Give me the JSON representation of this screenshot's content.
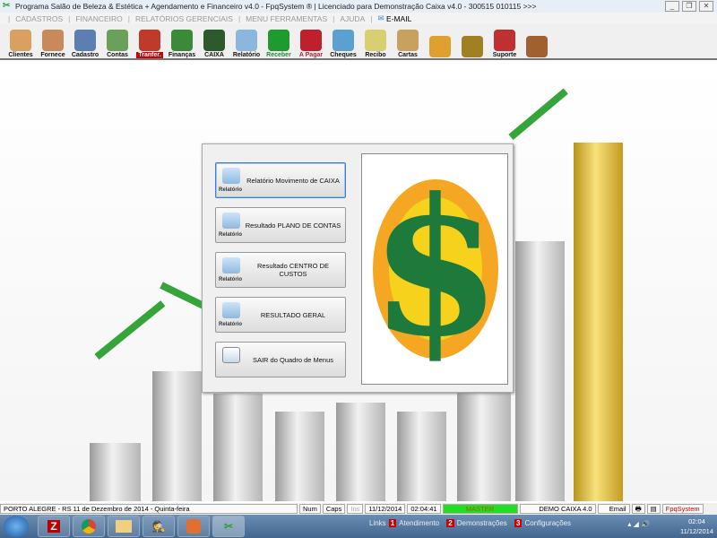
{
  "title": "Programa Salão de Beleza & Estética + Agendamento e Financeiro v4.0 - FpqSystem ® | Licenciado para  Demonstração Caixa v4.0 - 300515 010115 >>>",
  "menu": [
    "CADASTROS",
    "FINANCEIRO",
    "RELATÓRIOS GERENCIAIS",
    "MENU FERRAMENTAS",
    "AJUDA"
  ],
  "menu_email": "E-MAIL",
  "toolbar": [
    {
      "label": "Clientes",
      "color": "#d9a060"
    },
    {
      "label": "Fornece",
      "color": "#c88a5a"
    },
    {
      "label": "Cadastro",
      "color": "#5a7fb0"
    },
    {
      "label": "Contas",
      "color": "#6aa05a"
    },
    {
      "label": "Tranfer.",
      "color": "#c0392b"
    },
    {
      "label": "Finanças",
      "color": "#3a8a3a"
    },
    {
      "label": "CAIXA",
      "color": "#2c5a2c"
    },
    {
      "label": "Relatório",
      "color": "#8ab6e0"
    },
    {
      "label": "Receber",
      "color": "#1e9a2e"
    },
    {
      "label": "A Pagar",
      "color": "#c0202e"
    },
    {
      "label": "Cheques",
      "color": "#5aa0d0"
    },
    {
      "label": "Recibo",
      "color": "#d8d070"
    },
    {
      "label": "Cartas",
      "color": "#c8a060"
    },
    {
      "label": "",
      "color": "#e0a030"
    },
    {
      "label": "",
      "color": "#a08020"
    },
    {
      "label": "Suporte",
      "color": "#c03030"
    },
    {
      "label": "",
      "color": "#a06030"
    }
  ],
  "dialog": {
    "buttons": [
      {
        "label": "Relatório Movimento de CAIXA",
        "tag": "Relatório"
      },
      {
        "label": "Resultado PLANO DE CONTAS",
        "tag": "Relatório"
      },
      {
        "label": "Resultado CENTRO DE CUSTOS",
        "tag": "Relatório"
      },
      {
        "label": "RESULTADO GERAL",
        "tag": "Relatório"
      },
      {
        "label": "SAIR do Quadro de Menus",
        "tag": ""
      }
    ],
    "logo_symbol": "$"
  },
  "status": {
    "location": "PORTO ALEGRE - RS 11 de Dezembro de 2014 - Quinta-feira",
    "num": "Num",
    "caps": "Caps",
    "ins": "Ins",
    "date": "11/12/2014",
    "time": "02:04:41",
    "user": "MASTER",
    "db": "DEMO CAIXA 4.0",
    "email": "Email",
    "brand": "FpqSystem"
  },
  "taskbar": {
    "links_label": "Links",
    "links": [
      {
        "n": "1",
        "label": "Atendimento"
      },
      {
        "n": "2",
        "label": "Demonstrações"
      },
      {
        "n": "3",
        "label": "Configurações"
      }
    ],
    "clock_time": "02:04",
    "clock_date": "11/12/2014"
  }
}
